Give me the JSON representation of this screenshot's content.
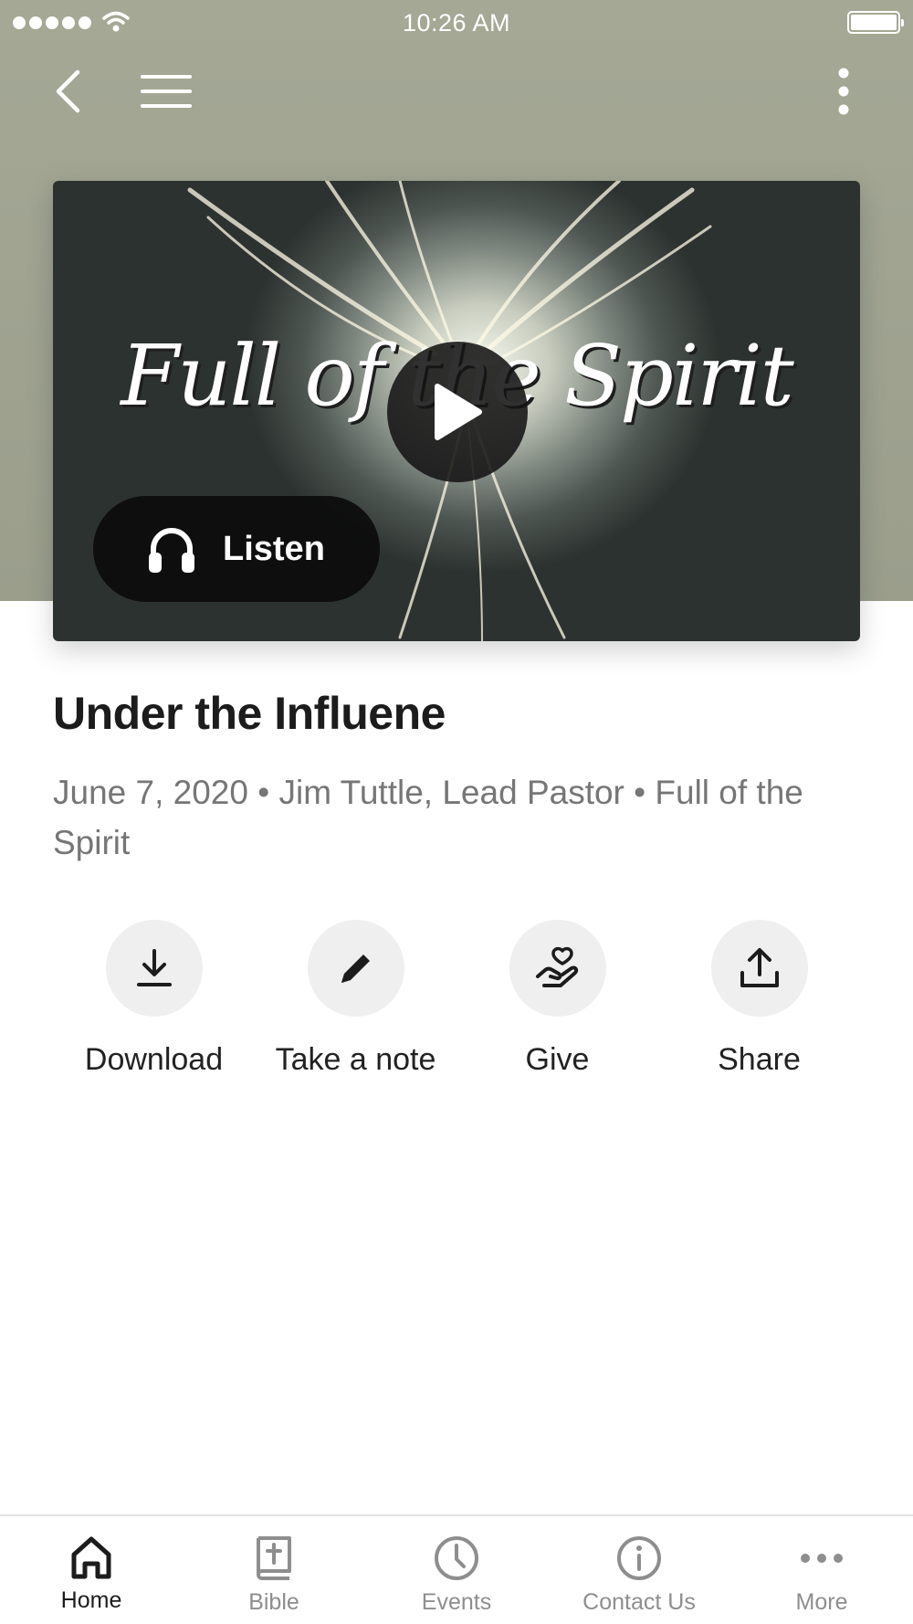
{
  "status_bar": {
    "time": "10:26 AM"
  },
  "media": {
    "series_art_text": "Full of the Spirit",
    "listen_label": "Listen"
  },
  "sermon": {
    "title": "Under the Influene",
    "meta": "June 7, 2020 • Jim Tuttle, Lead Pastor • Full of the Spirit"
  },
  "actions": [
    {
      "label": "Download",
      "icon": "download-icon"
    },
    {
      "label": "Take a note",
      "icon": "pencil-icon"
    },
    {
      "label": "Give",
      "icon": "heart-hand-icon"
    },
    {
      "label": "Share",
      "icon": "share-icon"
    }
  ],
  "tabs": [
    {
      "label": "Home",
      "icon": "home-icon",
      "active": true
    },
    {
      "label": "Bible",
      "icon": "bible-icon",
      "active": false
    },
    {
      "label": "Events",
      "icon": "clock-icon",
      "active": false
    },
    {
      "label": "Contact Us",
      "icon": "info-icon",
      "active": false
    },
    {
      "label": "More",
      "icon": "more-icon",
      "active": false
    }
  ],
  "colors": {
    "header_bg": "#a4a895",
    "active_tab": "#1c1c1c",
    "inactive_tab": "#8e8e8e",
    "action_circle": "#efeff0"
  }
}
